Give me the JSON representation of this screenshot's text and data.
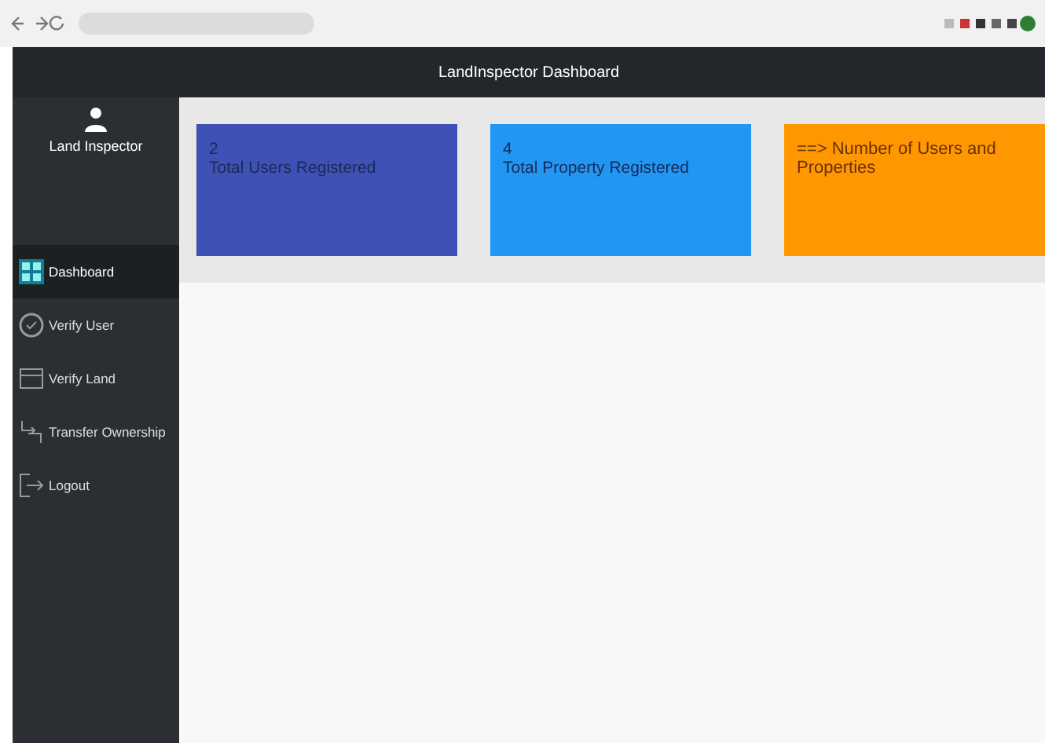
{
  "header": {
    "title": "LandInspector Dashboard"
  },
  "sidebar": {
    "user": "Land Inspector",
    "items": [
      {
        "label": "Dashboard",
        "kind": "grid",
        "selected": true
      },
      {
        "label": "Verify User",
        "kind": "shield",
        "selected": false
      },
      {
        "label": "Verify Land",
        "kind": "card",
        "selected": false
      },
      {
        "label": "Transfer Ownership",
        "kind": "transfer",
        "selected": false
      },
      {
        "label": "Logout",
        "kind": "logout",
        "selected": false
      }
    ]
  },
  "cards": [
    {
      "value": "2",
      "label": "Total Users Registered",
      "color": "#3f51b5"
    },
    {
      "value": "4",
      "label": "Total Property Registered",
      "color": "#2196f3"
    },
    {
      "label": "==> Number of Users and Properties",
      "color": "#ff9800"
    }
  ]
}
